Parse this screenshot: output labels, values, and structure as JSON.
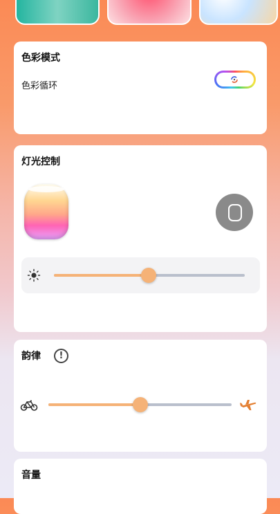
{
  "color_mode": {
    "title": "色彩模式",
    "cycle_label": "色彩循环",
    "toggle_on": true,
    "toggle_colors": [
      "#ff4f5a",
      "#ffb13d",
      "#f2e640",
      "#43d46d",
      "#3ec7ef",
      "#4d6ef5",
      "#b74ff0"
    ]
  },
  "light_control": {
    "title": "灯光控制",
    "device_icon": "speaker-icon",
    "brightness_icon": "sun-icon",
    "brightness_level": 0.5
  },
  "rhythm": {
    "title": "韵律",
    "info_icon": "info-icon",
    "slow_icon": "bicycle-icon",
    "fast_icon": "airplane-icon",
    "rhythm_level": 0.5
  },
  "volume": {
    "title": "音量"
  },
  "colors": {
    "accent": "#f5b277",
    "track_inactive": "#b9bfcc",
    "airplane": "#e37d2f"
  }
}
